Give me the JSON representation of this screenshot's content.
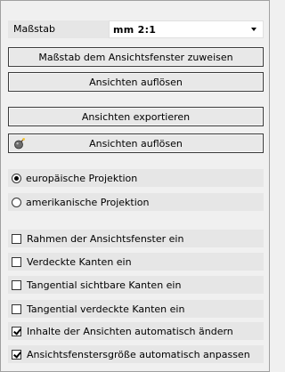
{
  "scale": {
    "label": "Maßstab",
    "value": "mm 2:1"
  },
  "buttons": {
    "assign_scale": "Maßstab dem Ansichtsfenster zuweisen",
    "dissolve_views": "Ansichten auflösen",
    "export_views": "Ansichten exportieren",
    "dissolve_views_icon": "Ansichten auflösen"
  },
  "projection": {
    "european": "europäische Projektion",
    "american": "amerikanische Projektion",
    "selected": "european"
  },
  "options": [
    {
      "label": "Rahmen der Ansichtsfenster ein",
      "checked": false
    },
    {
      "label": "Verdeckte Kanten ein",
      "checked": false
    },
    {
      "label": "Tangential sichtbare Kanten ein",
      "checked": false
    },
    {
      "label": "Tangential verdeckte Kanten ein",
      "checked": false
    },
    {
      "label": "Inhalte der Ansichten automatisch ändern",
      "checked": true
    },
    {
      "label": "Ansichtsfenstersgröße automatisch anpassen",
      "checked": true
    }
  ]
}
